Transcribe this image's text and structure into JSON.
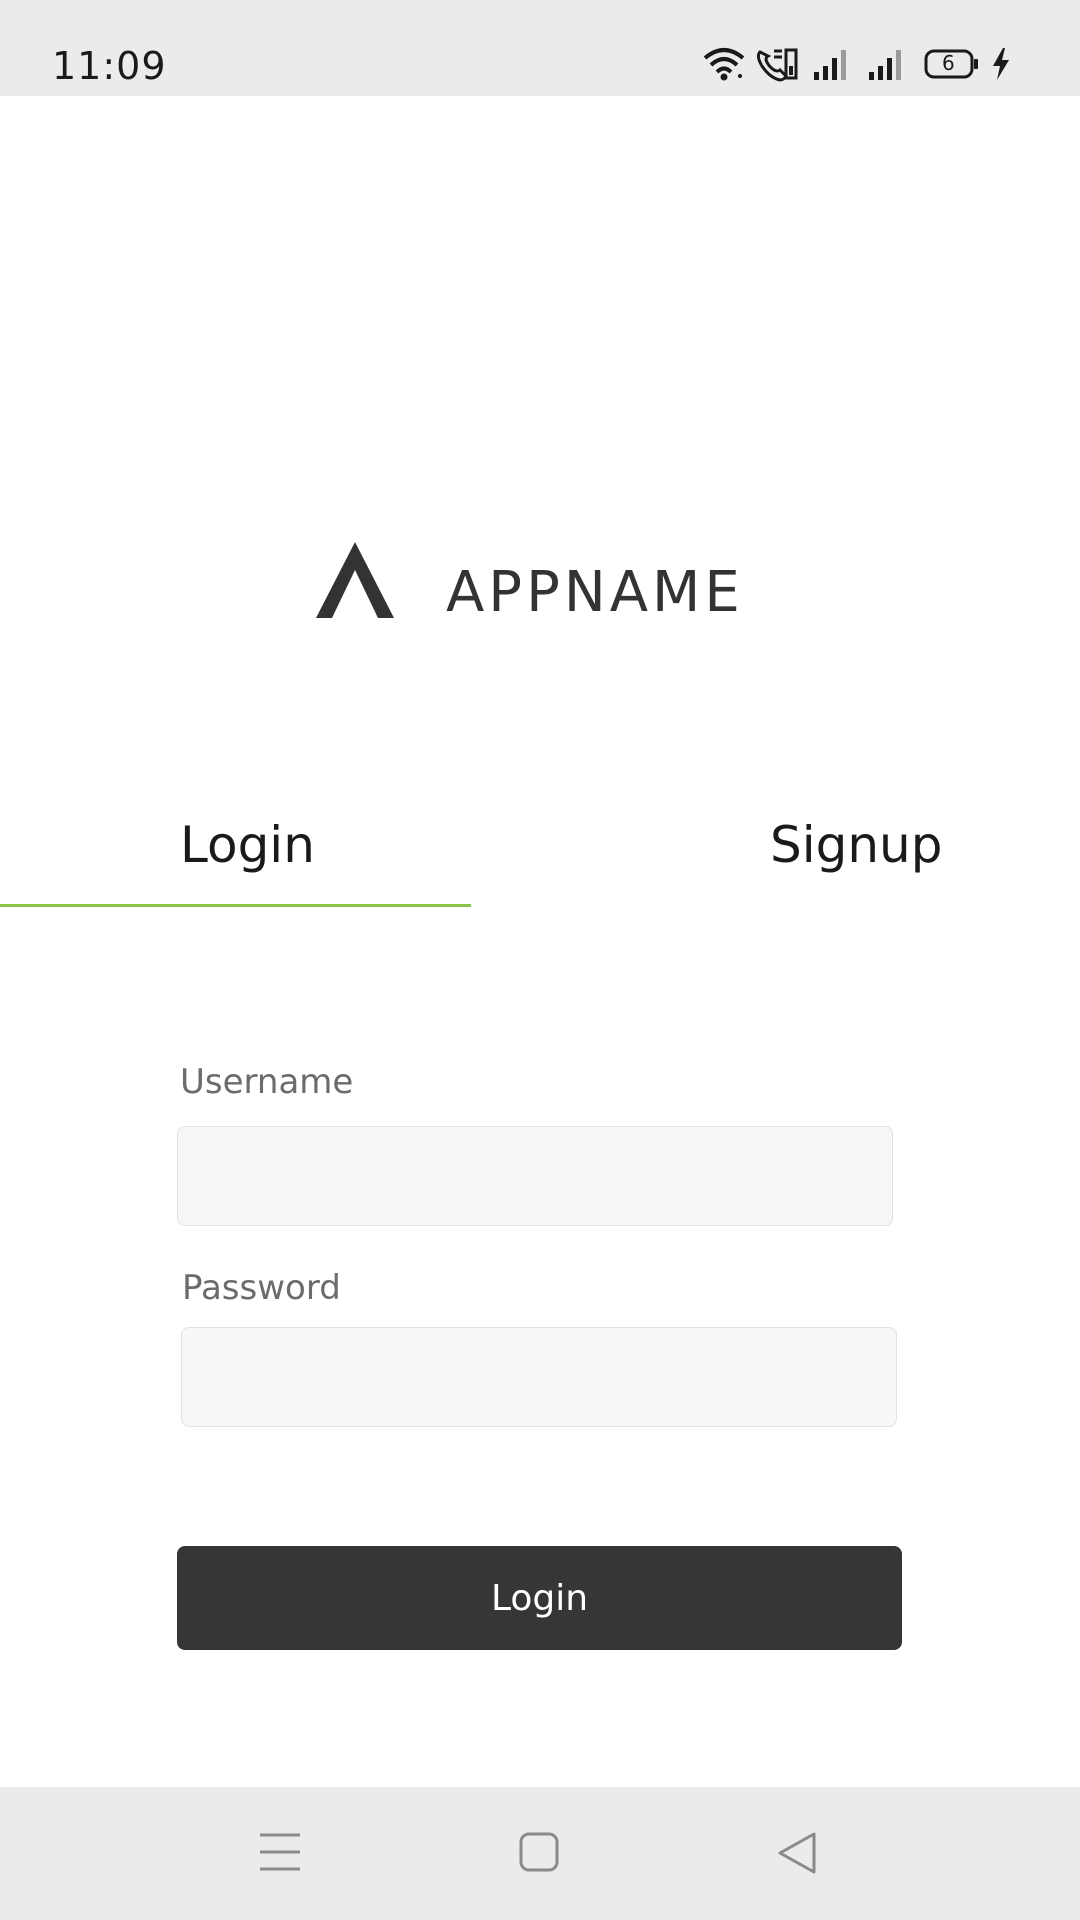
{
  "status_bar": {
    "time": "11:09",
    "icons": [
      "wifi-icon",
      "volte-call-icon",
      "signal-1-icon",
      "signal-2-icon",
      "battery-icon",
      "charging-icon"
    ],
    "battery_level": "6"
  },
  "logo": {
    "text": "APPNAME"
  },
  "tabs": {
    "login": "Login",
    "signup": "Signup",
    "active": "login",
    "accent_color": "#8bc34a"
  },
  "form": {
    "username_label": "Username",
    "username_value": "",
    "password_label": "Password",
    "password_value": "",
    "submit_label": "Login"
  },
  "nav_bar": {
    "icons": [
      "menu-icon",
      "home-icon",
      "back-icon"
    ]
  },
  "colors": {
    "button_bg": "#363636",
    "bar_bg": "#ebebeb",
    "input_bg": "#f7f7f7"
  }
}
